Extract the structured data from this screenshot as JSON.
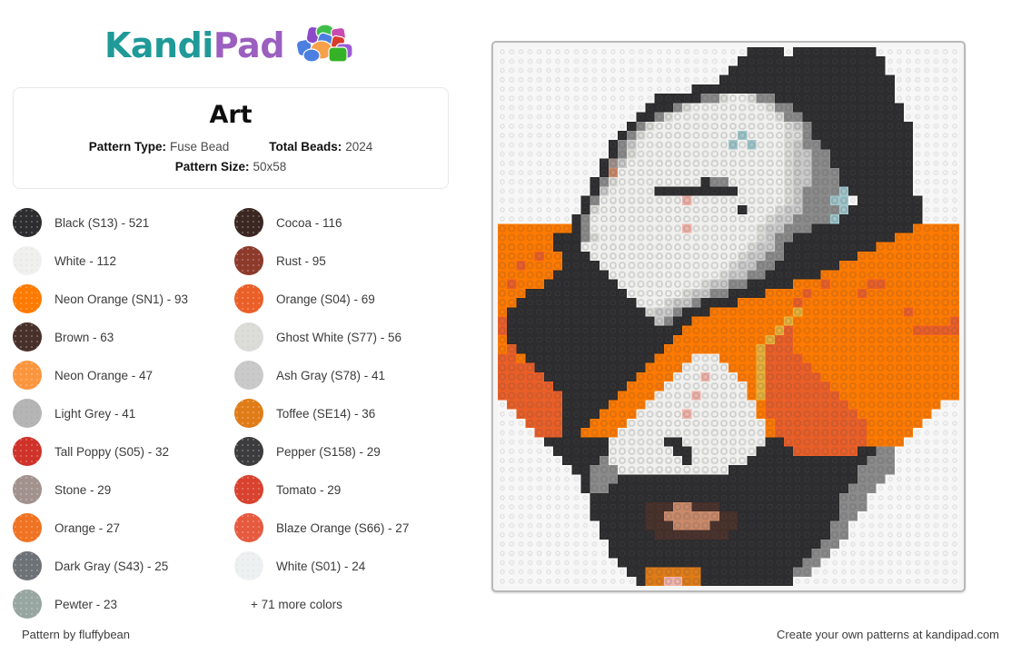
{
  "brand": {
    "name_part1": "Kandi",
    "name_part2": "Pad",
    "color_teal": "#1f9a98",
    "color_purple": "#9b5fc0",
    "beads_icon": "bead-cluster-icon"
  },
  "info": {
    "title": "Art",
    "pattern_type_label": "Pattern Type:",
    "pattern_type_value": "Fuse Bead",
    "total_beads_label": "Total Beads:",
    "total_beads_value": "2024",
    "pattern_size_label": "Pattern Size:",
    "pattern_size_value": "50x58"
  },
  "legend": {
    "more_label": "+ 71 more colors",
    "items": [
      {
        "label": "Black (S13) - 521",
        "color": "#2d2d2f",
        "pale": false
      },
      {
        "label": "Cocoa - 116",
        "color": "#3b2722",
        "pale": false
      },
      {
        "label": "White - 112",
        "color": "#f0f0ee",
        "pale": true
      },
      {
        "label": "Rust - 95",
        "color": "#8d3a2b",
        "pale": false
      },
      {
        "label": "Neon Orange (SN1) - 93",
        "color": "#ff7a00",
        "pale": false
      },
      {
        "label": "Orange (S04) - 69",
        "color": "#ea5f28",
        "pale": false
      },
      {
        "label": "Brown - 63",
        "color": "#48302a",
        "pale": false
      },
      {
        "label": "Ghost White (S77) - 56",
        "color": "#dcdcd8",
        "pale": true
      },
      {
        "label": "Neon Orange - 47",
        "color": "#fb963f",
        "pale": false
      },
      {
        "label": "Ash Gray (S78) - 41",
        "color": "#cacaca",
        "pale": true
      },
      {
        "label": "Light Grey - 41",
        "color": "#b5b5b5",
        "pale": true
      },
      {
        "label": "Toffee (SE14) - 36",
        "color": "#e07c18",
        "pale": false
      },
      {
        "label": "Tall Poppy (S05) - 32",
        "color": "#cf3229",
        "pale": false
      },
      {
        "label": "Pepper (S158) - 29",
        "color": "#3c3c3e",
        "pale": false
      },
      {
        "label": "Stone - 29",
        "color": "#a2928e",
        "pale": false
      },
      {
        "label": "Tomato - 29",
        "color": "#d8422f",
        "pale": false
      },
      {
        "label": "Orange - 27",
        "color": "#ef7322",
        "pale": false
      },
      {
        "label": "Blaze Orange (S66) - 27",
        "color": "#e65a3f",
        "pale": false
      },
      {
        "label": "Dark Gray (S43) - 25",
        "color": "#6d7277",
        "pale": false
      },
      {
        "label": "White (S01) - 24",
        "color": "#eef1f1",
        "pale": true
      },
      {
        "label": "Pewter - 23",
        "color": "#98a6a1",
        "pale": false
      }
    ]
  },
  "board": {
    "name": "fuse-bead-pegboard",
    "cols": 50,
    "rows": 58,
    "peg_color": "#f7f7f7",
    "peg_hole_color": "#d9d9d9",
    "board_color": "#f5f5f5",
    "palette": {
      "0": "transparent",
      "K": "#2d2d2f",
      "P": "#3c3c3e",
      "D": "#5a5a5c",
      "G": "#8b8b8b",
      "L": "#b5b5b5",
      "A": "#cacaca",
      "H": "#dcdcd8",
      "W": "#f0f0ee",
      "S": "#eef1f1",
      "N": "#a2928e",
      "E": "#98a6a1",
      "Y": "#6d7277",
      "C": "#3b2722",
      "B": "#48302a",
      "R": "#8d3a2b",
      "T": "#d8422f",
      "Q": "#cf3229",
      "Z": "#e65a3f",
      "O": "#ff7a00",
      "o": "#fb963f",
      "F": "#ea5f28",
      "f": "#ef7322",
      "X": "#e07c18",
      "M": "#c9852f",
      "J": "#e8b23c",
      "I": "#c98a6a",
      "p": "#f0b4ab",
      "c": "#9fc6cb",
      "g": "#7f7f7f"
    },
    "rows_data": [
      "000000000000000000000000000KKKK0KKKKKKKKK000000000",
      "00000000000000000000000000KKKKKKKKKKKKKKKK00000000",
      "0000000000000000000000000KKKKKKKKKKKKKKKKK00000000",
      "000000000000000000000000KKKKKKKKKKKKKKKKKKK0000000",
      "000000000000000000000KKKKKKKKKKKKKKKKKKKKKK0000000",
      "00000000000000000KKKKKGGHWWHGGKKKKKKKKKKKKK0000000",
      "0000000000000000KKKGHWWWWWWWWHGGKKKKKKKKKKKK000000",
      "000000000000000KKGHWWWWWWWWWWWHGGKKKKKKKKKKK000000",
      "00000000000000KGHWWWWWWWWWWWWWWHAGKKKKKKKKKKK00000",
      "0000000000000KGHWWWWWWWWWWcWWWWHHGKKKKKKKKKKK00000",
      "000000000000KGAWWWWWWWWWWcWcWWWHAGGKKKKKKKKKK00000",
      "000000000000KGHWWWWWWWWWWWWWWWWHAAGGKKKKKKKKK00000",
      "00000000000KNAWWWWWWWWWWWWWWWWWHAAGGKKKKKKKKK00000",
      "00000000000KIWWWWWWWWWWWWWWWWWWHAAGGGKKKKKKKK00000",
      "0000000000KGHWWWWWWWWWKGGWWWWWWHAAGGGKKKKKKKK00000",
      "0000000000KAWWWWWKKKKKKKKKWWWWWHAGGGGcKKKKKKK00000",
      "000000000KGWWWWWWWWWpWWWWWWWWWWHAGGGcckKKKKKKK0000",
      "000000000KHWWWWWWWWWWWWWWWKWWWHAAGGGGcKKKKKKKK0000",
      "00000000KGWWWWWWWWWWWWWWWWWWWHAAGGGGcKKKKKKKKK0000",
      "OOOOOOOOKGWWWWWWWWWWpWWWWWWWHAAGGGKKKKKKKKKKKOOOOO",
      "OOOOOOKKKGHWWWWWWWWWWWWWWWWWHAGGKKKKKKKKKKKOOOOOOO",
      "OOOOOOKKKWWWWWWWWWWWWWWWWWWHAAGKKKKKKKKKKOOOOOOOOO",
      "OOOOFOOKKKWWWWWWWWWWWWWWWWHAAGGKKKKKKKKOOOOOOOOOOO",
      "OOFOOOOKKKKWWWWWWWWWWWWWWHAAGGKKKKKKKOOOOOOOOOOOOO",
      "OOOOOOKKKKKKWWWWWWWWWWWWHAAGGKKKKKKOOOOOOOOOOOOOOO",
      "OFOOOKKKKKKKKWWWWWWWWWHAAGGKKKKKOOOFOOOOFFOOOOOOOO",
      "OOOKKKKKKKKKKKWWWWWWHAAGGKKKKOOOOFOOOOOFOOOOOOOOOO",
      "OOKKKKKKKKKKKKKWWWHAAGKKKKOOOOOOFOOOOOOOOOOOOOOOOO",
      "OKKKKKKKKKKKKKKKHAAGKKKOOOOOOOOOJOOOOOOOOOOOFOOOOO",
      "FKKKKKKKKKKKKKKKKAGKKOOOOOOOOOOJOOOOOOOOOOOOOOOOOF",
      "FKKKKKKKKKKKKKKKKKKKOOOOOOOOOOJFOOOOOOOOOOOOOFFFFF",
      "OKKKKKKKKKKKKKKKKKKOOOOOOOOOOJFFOOOOOOOOOOOOOOOOOO",
      "OFKKKKKKKKKKKKKKKKOOOOOOOOOOJFFFOOOOOOOOOOOOOOOOOO",
      "FFOKKKKKKKKKKKKKKOOOOWWWOOOOJFFFFOOOOOOOOOOOOOOOOO",
      "FFFFKKKKKKKKKKKKOOOOWWWWWOOOJFFFFFOOOOOOOOOOOOOOOO",
      "FFFFFKKKKKKKKKKOOOOWWWpWWWOOJFFFFFFOOOOOOOOOOOOOOO",
      "FFFFFFKKKKKKKKOOOOWWWWWWWWWOJFFFFFFFOOOOOOOOOOOOOO",
      "FFFFFFFKKKKKKOOOOWWWWpWWWWWOJFFFFFFFFOOOOOOOOOOOOO",
      "0FFFFFFKKKKKOOOOWWWWWWWWWWWWOFFFFFFFFFOOOOOOOOOO00",
      "00FFFFFKKKKOOOOWWWWWpWWWWWWWOFFFFFFFFFFOOOOOOOO000",
      "000FFFFKKKOOOOWWWWWWWWWWWWWWWOFFFFFFFFFFOOOOOO0000",
      "0000FFFKKOOOOWWWWWWWWWWWWWWWWOFFFFFFFFFFOOOOO00000",
      "00000KKKKKKKWWWWWWKKWWWWWWWWWKKFFFFFFFFFOOOO000000",
      "000000KKKKKKWWWWWWWKKWWWWWWWKKKKFFFFFFFKKGG0000000",
      "0000000KKKKGWWWWWWWWKWWWWWWKKKKKKKKKKKKKGGG0000000",
      "00000000KKGGGWWWWWWWWWWWWKKKKKKKKKKKKKKGGGG0000000",
      "000000000KGGGKKKKKKKKKKKKKKKKKKKKKKKKKKGGG00000000",
      "000000000KGGKKKKKKKKKKKKKKKKKKKKKKKKKKGGG000000000",
      "0000000000KKKKKKKKKKKKKKKKKKKKKKKKKKKGGG0000000000",
      "0000000000KKKKKKBBBIIBBBKKKKKKKKKKKKKGGG0000000000",
      "0000000000KKKKKKBBIIIIIIBBKKKKKKKKKKKGG00000000000",
      "00000000000KKKKKBBBIIIIBBBKKKKKKKKKKGG000000000000",
      "00000000000KKKKKKBBBBBBBBKKKKKKKKKKKGG000000000000",
      "000000000000KKKKKKKKKKKKKKKKKKKKKKKGG0000000000000",
      "000000000000KKKKKKKKKKKKKKKKKKKKKKGG00000000000000",
      "0000000000000KKKKKKKKKKKKKKKKKKKKGG000000000000000",
      "00000000000000KKXXXXXXKKKKKKKKKKGG0000000000000000",
      "000000000000000KXXppXXKKKKKKKKKK000000000000000000"
    ]
  },
  "footer": {
    "left": "Pattern by fluffybean",
    "right": "Create your own patterns at kandipad.com"
  }
}
